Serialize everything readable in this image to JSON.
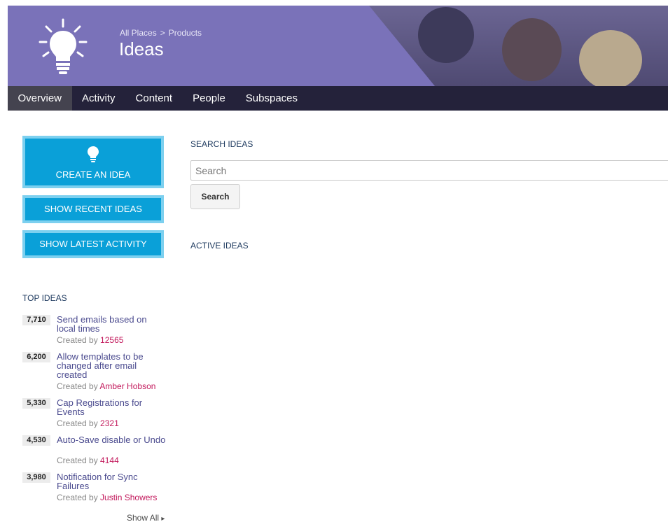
{
  "header": {
    "breadcrumb": [
      "All Places",
      "Products"
    ],
    "breadcrumb_separator": ">",
    "title": "Ideas",
    "icon": "lightbulb-icon",
    "colors": {
      "banner": "#7a72b9",
      "nav": "#24223a",
      "nav_active": "#44434f"
    }
  },
  "nav": {
    "items": [
      {
        "label": "Overview",
        "active": true
      },
      {
        "label": "Activity",
        "active": false
      },
      {
        "label": "Content",
        "active": false
      },
      {
        "label": "People",
        "active": false
      },
      {
        "label": "Subspaces",
        "active": false
      }
    ]
  },
  "actions": {
    "create_label": "CREATE AN IDEA",
    "create_icon": "lightbulb-icon",
    "show_recent_label": "SHOW RECENT IDEAS",
    "show_latest_label": "SHOW LATEST ACTIVITY",
    "color": "#0aa0d8"
  },
  "top_ideas": {
    "heading": "TOP IDEAS",
    "created_by_prefix": "Created by",
    "items": [
      {
        "count": "7,710",
        "title": "Send emails based on local times",
        "author": "12565"
      },
      {
        "count": "6,200",
        "title": "Allow templates to be changed after email created",
        "author": "Amber Hobson"
      },
      {
        "count": "5,330",
        "title": "Cap Registrations for Events",
        "author": "2321"
      },
      {
        "count": "4,530",
        "title": "Auto-Save disable or Undo",
        "author": "4144"
      },
      {
        "count": "3,980",
        "title": "Notification for Sync Failures",
        "author": "Justin Showers"
      }
    ],
    "show_all_label": "Show All",
    "show_all_icon": "chevron-right-icon"
  },
  "search": {
    "heading": "SEARCH IDEAS",
    "placeholder": "Search",
    "value": "",
    "button_label": "Search"
  },
  "active_ideas": {
    "heading": "ACTIVE IDEAS"
  }
}
